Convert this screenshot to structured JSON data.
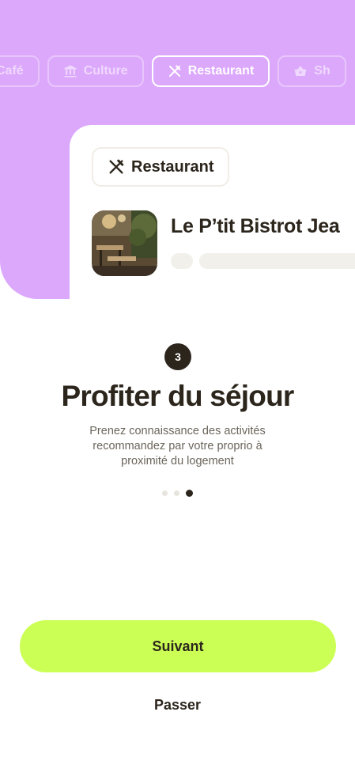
{
  "categories": [
    {
      "label": "Café",
      "icon": "cafe-icon",
      "active": false
    },
    {
      "label": "Culture",
      "icon": "museum-icon",
      "active": false
    },
    {
      "label": "Restaurant",
      "icon": "cutlery-icon",
      "active": true
    },
    {
      "label": "Sh",
      "icon": "shopping-basket-icon",
      "active": false
    }
  ],
  "card": {
    "category_label": "Restaurant",
    "category_icon": "cutlery-icon",
    "place_name": "Le P’tit Bistrot Jea"
  },
  "onboarding": {
    "step_number": "3",
    "title": "Profiter du séjour",
    "description": "Prenez connaissance des activités recommandez par votre proprio à proximité du logement",
    "pages_total": 3,
    "current_page": 3
  },
  "actions": {
    "next_label": "Suivant",
    "skip_label": "Passer"
  },
  "colors": {
    "hero_bg": "#dca8fb",
    "primary_button": "#ccff55",
    "text_dark": "#2b251c"
  }
}
